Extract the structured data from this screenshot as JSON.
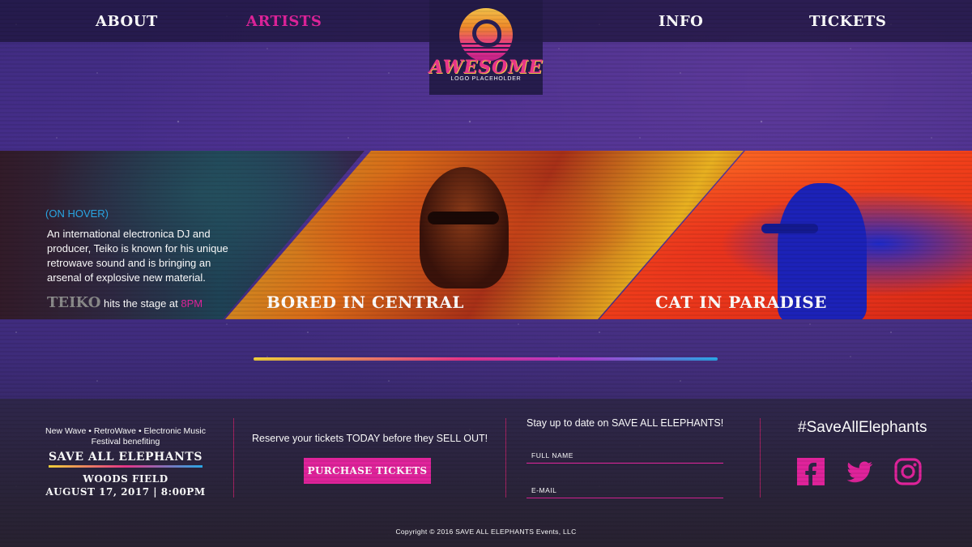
{
  "nav": {
    "about": "ABOUT",
    "artists": "ARTISTS",
    "info": "INFO",
    "tickets": "TICKETS"
  },
  "logo": {
    "word": "AWESOME",
    "sub": "LOGO PLACEHOLDER"
  },
  "banner": {
    "hover_tag": "(ON HOVER)",
    "description": "An international electronica DJ and producer, Teiko is known for his unique retrowave sound and is bringing an arsenal of explosive new material.",
    "stage_artist": "TEIKO",
    "stage_text": " hits the stage at ",
    "stage_time": "8PM",
    "artists": [
      "BORED IN CENTRAL",
      "CAT IN PARADISE"
    ]
  },
  "footer": {
    "genres": "New Wave • RetroWave • Electronic Music Festival benefiting",
    "org": "SAVE ALL ELEPHANTS",
    "venue": "WOODS FIELD",
    "datetime": "AUGUST 17, 2017 | 8:00PM",
    "reserve": "Reserve your tickets TODAY before they SELL OUT!",
    "purchase_label": "PURCHASE TICKETS",
    "stay": "Stay up to date on SAVE ALL ELEPHANTS!",
    "full_name_placeholder": "FULL NAME",
    "email_placeholder": "E-MAIL",
    "hashtag": "#SaveAllElephants",
    "social_icons": [
      "facebook-icon",
      "twitter-icon",
      "instagram-icon"
    ],
    "copyright": "Copyright © 2016 SAVE ALL ELEPHANTS Events, LLC"
  },
  "colors": {
    "accent": "#e0239b",
    "link_blue": "#2aa9e8",
    "background": "#3a2a78"
  }
}
